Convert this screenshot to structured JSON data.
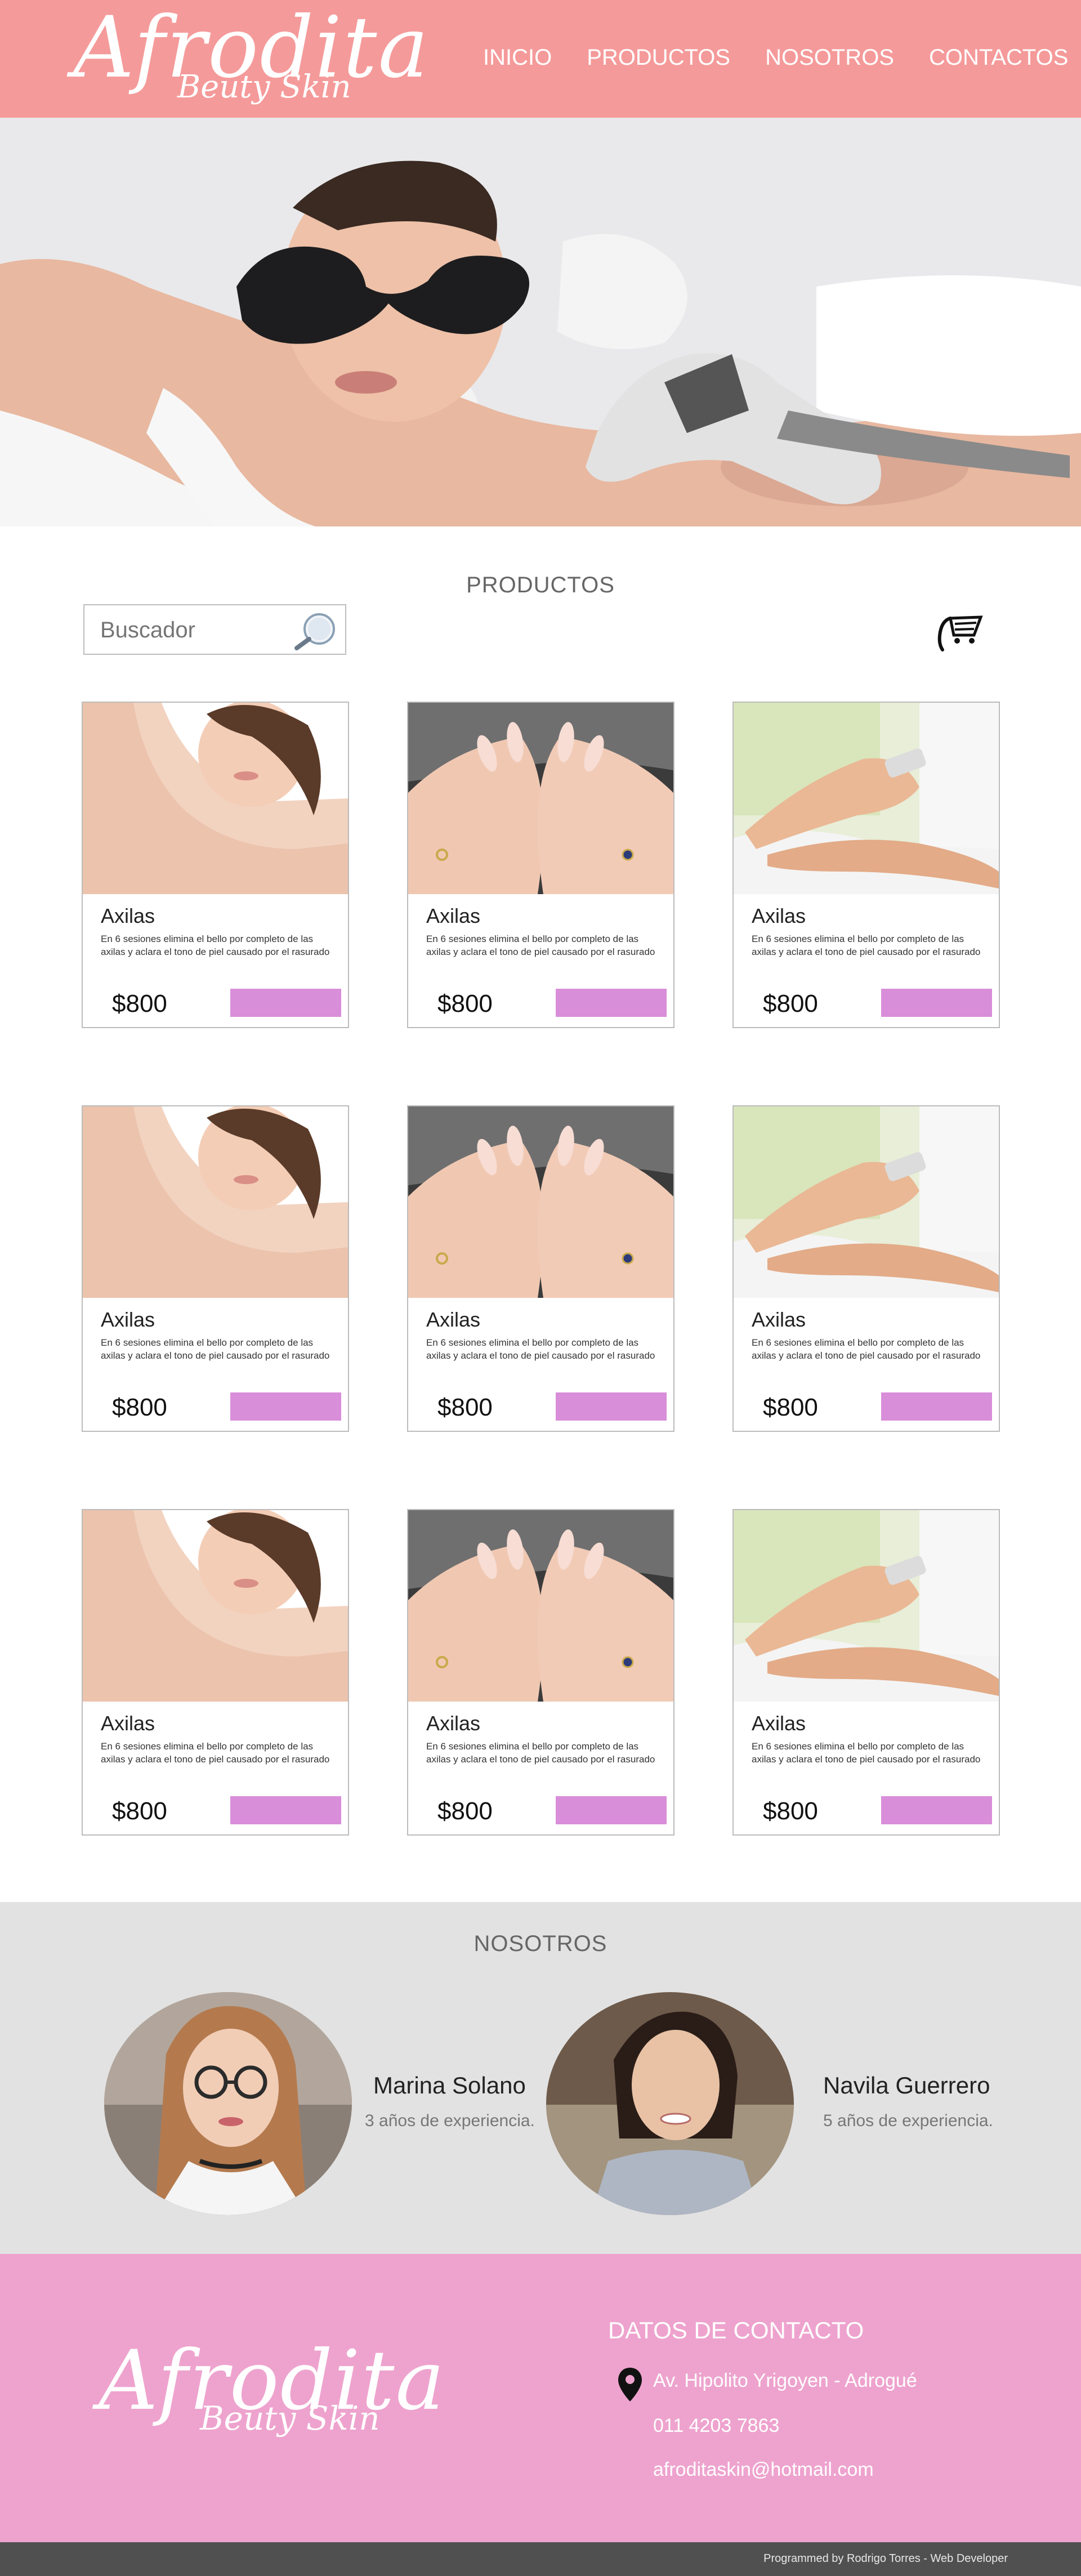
{
  "brand": {
    "name": "Afrodita",
    "tagline": "Beuty Skin"
  },
  "nav": [
    {
      "label": "INICIO"
    },
    {
      "label": "PRODUCTOS"
    },
    {
      "label": "NOSOTROS"
    },
    {
      "label": "CONTACTOS"
    }
  ],
  "products_section": {
    "title": "PRODUCTOS",
    "search_placeholder": "Buscador",
    "cards": [
      {
        "name": "Axilas",
        "description": "En 6 sesiones elimina el bello por completo de las axilas y aclara el tono de piel causado por el rasurado",
        "price": "$800",
        "image": "armpit-woman-photo"
      },
      {
        "name": "Axilas",
        "description": "En 6 sesiones elimina el bello por completo de las axilas y aclara el tono de piel causado por el rasurado",
        "price": "$800",
        "image": "manicure-nails-photo"
      },
      {
        "name": "Axilas",
        "description": "En 6 sesiones elimina el bello por completo de las axilas y aclara el tono de piel causado por el rasurado",
        "price": "$800",
        "image": "leg-laser-photo"
      },
      {
        "name": "Axilas",
        "description": "En 6 sesiones elimina el bello por completo de las axilas y aclara el tono de piel causado por el rasurado",
        "price": "$800",
        "image": "armpit-woman-photo"
      },
      {
        "name": "Axilas",
        "description": "En 6 sesiones elimina el bello por completo de las axilas y aclara el tono de piel causado por el rasurado",
        "price": "$800",
        "image": "manicure-nails-photo"
      },
      {
        "name": "Axilas",
        "description": "En 6 sesiones elimina el bello por completo de las axilas y aclara el tono de piel causado por el rasurado",
        "price": "$800",
        "image": "leg-laser-photo"
      },
      {
        "name": "Axilas",
        "description": "En 6 sesiones elimina el bello por completo de las axilas y aclara el tono de piel causado por el rasurado",
        "price": "$800",
        "image": "armpit-woman-photo"
      },
      {
        "name": "Axilas",
        "description": "En 6 sesiones elimina el bello por completo de las axilas y aclara el tono de piel causado por el rasurado",
        "price": "$800",
        "image": "manicure-nails-photo"
      },
      {
        "name": "Axilas",
        "description": "En 6 sesiones elimina el bello por completo de las axilas y aclara el tono de piel causado por el rasurado",
        "price": "$800",
        "image": "leg-laser-photo"
      }
    ]
  },
  "about": {
    "title": "NOSOTROS",
    "members": [
      {
        "name": "Marina Solano",
        "experience": "3 años de experiencia."
      },
      {
        "name": "Navila Guerrero",
        "experience": "5 años de experiencia."
      }
    ]
  },
  "footer": {
    "contact_title": "DATOS DE CONTACTO",
    "address": "Av. Hipolito Yrigoyen - Adrogué",
    "phone": "011 4203 7863",
    "email": "afroditaskin@hotmail.com",
    "credits": "Programmed by Rodrigo Torres - Web Developer"
  },
  "colors": {
    "header": "#f59a9a",
    "buy_button": "#d98ed9",
    "about_bg": "#e2e2e2",
    "footer_bg": "#eea3ce",
    "bottom_bar": "#505050"
  }
}
